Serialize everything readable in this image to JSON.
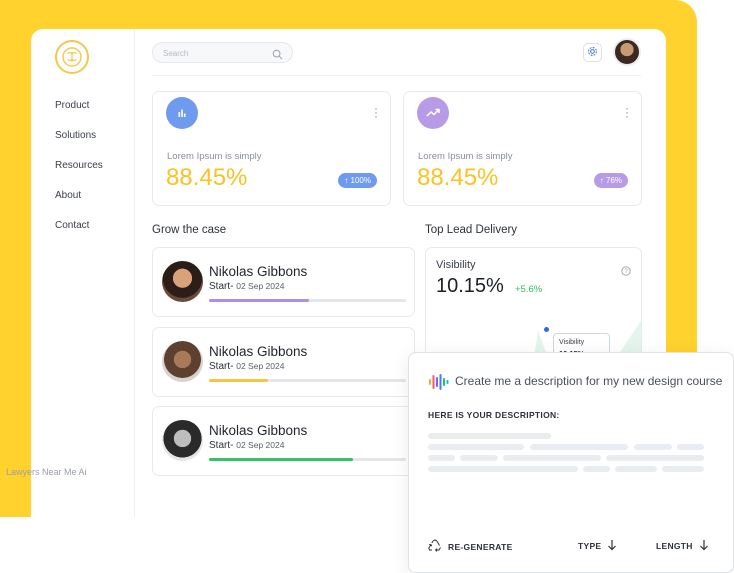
{
  "sidebar": {
    "logo_icon": "brain-icon",
    "items": [
      {
        "label": "Product"
      },
      {
        "label": "Solutions"
      },
      {
        "label": "Resources"
      },
      {
        "label": "About"
      },
      {
        "label": "Contact"
      }
    ],
    "footer": "Lawyers Near Me Ai"
  },
  "header": {
    "search_placeholder": "Search",
    "search_icon": "search-icon",
    "settings_icon": "gear-icon"
  },
  "stats": [
    {
      "icon": "bar-chart-icon",
      "label": "Lorem Ipsum is simply",
      "value": "88.45%",
      "badge": "↑ 100%",
      "accent": "#6f9bef",
      "badge_color": "#6f9bef"
    },
    {
      "icon": "trend-up-icon",
      "label": "Lorem Ipsum is simply",
      "value": "88.45%",
      "badge": "↑ 76%",
      "accent": "#b79be6",
      "badge_color": "#b79be6"
    }
  ],
  "grow": {
    "title": "Grow the case",
    "people": [
      {
        "name": "Nikolas Gibbons",
        "start_label": "Start-",
        "date": "02 Sep 2024",
        "progress": 0.51,
        "color": "#b08ee8"
      },
      {
        "name": "Nikolas Gibbons",
        "start_label": "Start-",
        "date": "02 Sep 2024",
        "progress": 0.3,
        "color": "#f5c542"
      },
      {
        "name": "Nikolas Gibbons",
        "start_label": "Start-",
        "date": "02 Sep 2024",
        "progress": 0.73,
        "color": "#35c267"
      }
    ]
  },
  "lead": {
    "title": "Top Lead Delivery",
    "metric_label": "Visibility",
    "metric_value": "10.15%",
    "delta": "+5.6%",
    "tooltip_label": "Visibility",
    "tooltip_value": "10.15%"
  },
  "ai": {
    "prompt": "Create me a description for my new design course",
    "heading": "HERE IS YOUR DESCRIPTION:",
    "actions": [
      {
        "label": "RE-GENERATE",
        "icon": "recycle-icon"
      },
      {
        "label": "TYPE",
        "icon": "arrow-down-icon"
      },
      {
        "label": "LENGTH",
        "icon": "arrow-down-icon"
      }
    ]
  }
}
